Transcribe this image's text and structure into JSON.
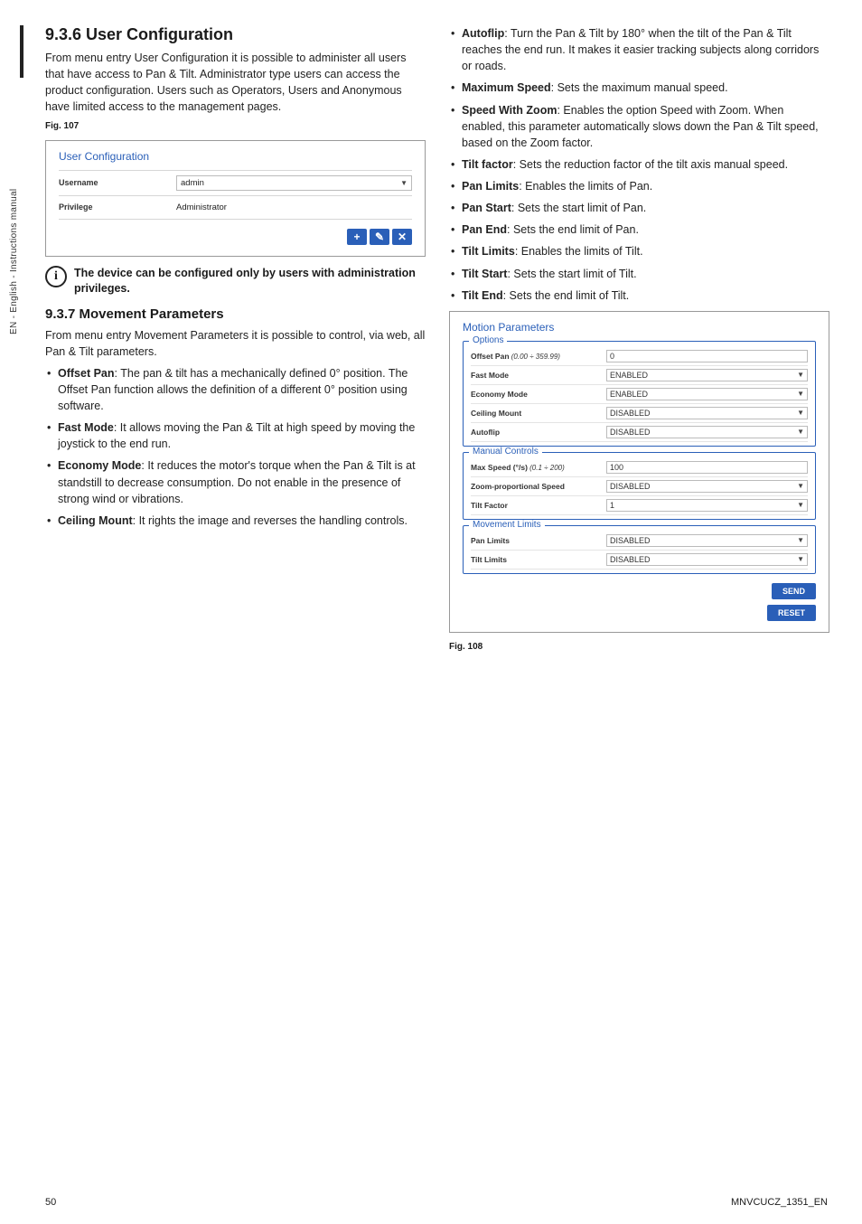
{
  "side_text": "EN - English - Instructions manual",
  "left": {
    "h1": "9.3.6 User Configuration",
    "p1": "From menu entry User Configuration it is possible to administer all users that have access to Pan & Tilt. Administrator type users can access the product configuration. Users such as Operators, Users and Anonymous have limited access to the management pages.",
    "fig107_caption": "Fig. 107",
    "ss1": {
      "title": "User Configuration",
      "username_label": "Username",
      "username_val": "admin",
      "privilege_label": "Privilege",
      "privilege_val": "Administrator",
      "btn1": "+",
      "btn2": "✎",
      "btn3": "✕"
    },
    "info": "The device can be configured only by users with administration privileges.",
    "h2": "9.3.7 Movement Parameters",
    "p2": "From menu entry Movement Parameters  it is possible to control, via web, all Pan & Tilt parameters.",
    "bullets": [
      {
        "b": "Offset Pan",
        "t": ": The pan & tilt has a mechanically defined 0° position. The Offset Pan function allows the definition of a different 0° position using software."
      },
      {
        "b": "Fast Mode",
        "t": ": It allows moving the Pan & Tilt at high speed by moving the joystick to the end run."
      },
      {
        "b": "Economy Mode",
        "t": ": It reduces the motor's torque when the Pan & Tilt is at standstill to decrease consumption. Do not enable in the presence of strong wind or vibrations."
      },
      {
        "b": "Ceiling Mount",
        "t": ": It rights the image and reverses the handling controls."
      }
    ]
  },
  "right": {
    "bullets": [
      {
        "b": "Autoflip",
        "t": ": Turn the Pan & Tilt by 180° when the tilt of the Pan & Tilt reaches the end run. It makes it easier tracking subjects along corridors or roads."
      },
      {
        "b": "Maximum Speed",
        "t": ": Sets the maximum manual speed."
      },
      {
        "b": "Speed With Zoom",
        "t": ": Enables the option Speed with Zoom. When enabled, this parameter automatically slows down the Pan & Tilt speed, based on the Zoom factor."
      },
      {
        "b": "Tilt factor",
        "t": ": Sets the reduction factor of the tilt axis manual speed."
      },
      {
        "b": "Pan Limits",
        "t": ": Enables the limits of Pan."
      },
      {
        "b": "Pan Start",
        "t": ": Sets the start limit of Pan."
      },
      {
        "b": "Pan End",
        "t": ": Sets the end limit of Pan."
      },
      {
        "b": "Tilt Limits",
        "t": ": Enables the limits of Tilt."
      },
      {
        "b": "Tilt Start",
        "t": ": Sets the start limit of Tilt."
      },
      {
        "b": "Tilt End",
        "t": ": Sets the end limit of Tilt."
      }
    ],
    "ss2": {
      "title_main": "Motion Parameters",
      "fs1": "Options",
      "offset_label": "Offset Pan",
      "offset_range": " (0.00 ÷ 359.99)",
      "offset_val": "0",
      "fast_label": "Fast Mode",
      "fast_val": "ENABLED",
      "econ_label": "Economy Mode",
      "econ_val": "ENABLED",
      "ceil_label": "Ceiling Mount",
      "ceil_val": "DISABLED",
      "auto_label": "Autoflip",
      "auto_val": "DISABLED",
      "fs2": "Manual Controls",
      "maxs_label": "Max Speed (°/s)",
      "maxs_range": " (0.1 ÷ 200)",
      "maxs_val": "100",
      "zoom_label": "Zoom-proportional Speed",
      "zoom_val": "DISABLED",
      "tiltf_label": "Tilt Factor",
      "tiltf_val": "1",
      "fs3": "Movement Limits",
      "panl_label": "Pan Limits",
      "panl_val": "DISABLED",
      "tiltl_label": "Tilt Limits",
      "tiltl_val": "DISABLED",
      "send": "SEND",
      "reset": "RESET"
    },
    "fig108_caption": "Fig. 108"
  },
  "footer": {
    "page": "50",
    "doc": "MNVCUCZ_1351_EN"
  }
}
